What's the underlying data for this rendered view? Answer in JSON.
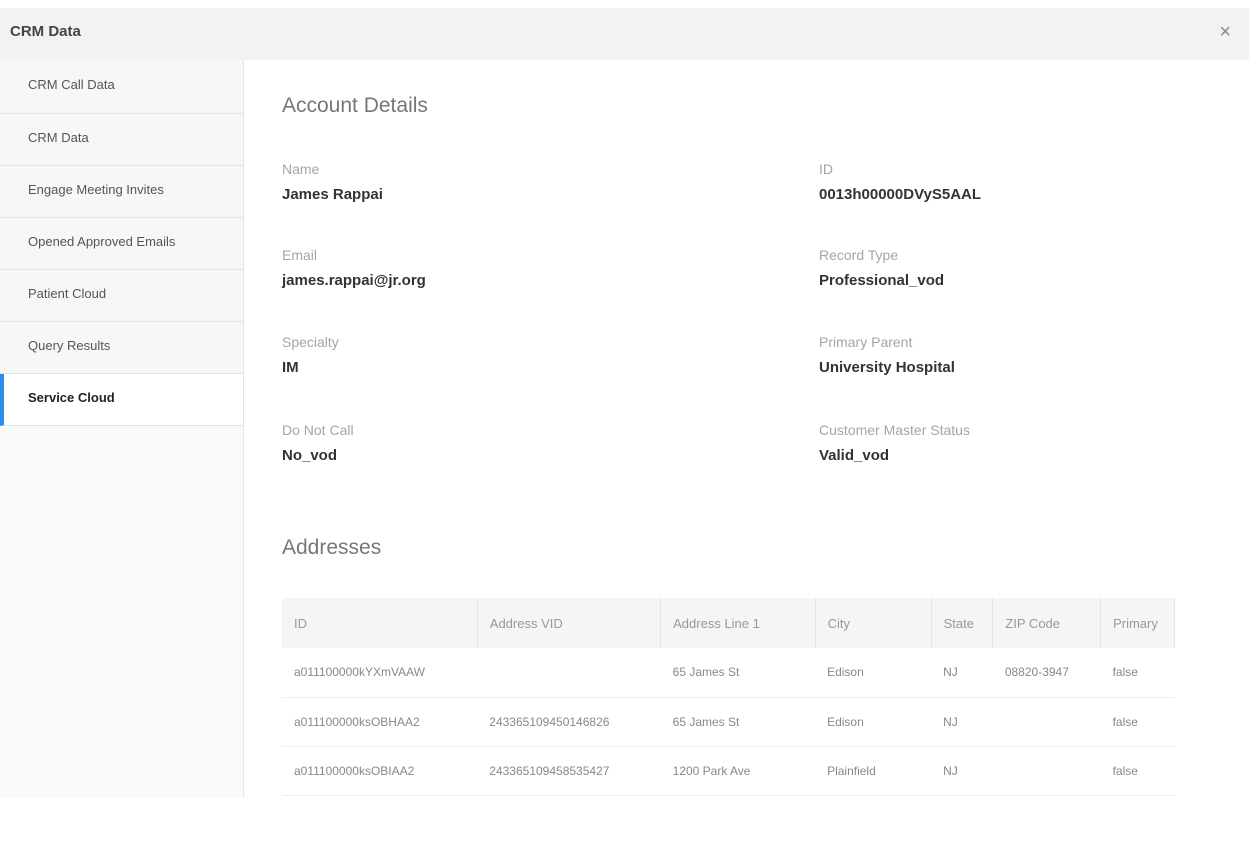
{
  "window": {
    "title": "CRM Data",
    "close_label": "×"
  },
  "sidebar": {
    "items": [
      {
        "label": "CRM Call Data"
      },
      {
        "label": "CRM Data"
      },
      {
        "label": "Engage Meeting Invites"
      },
      {
        "label": "Opened Approved Emails"
      },
      {
        "label": "Patient Cloud"
      },
      {
        "label": "Query Results"
      },
      {
        "label": "Service Cloud"
      }
    ],
    "active_item": "Service Cloud"
  },
  "account": {
    "section_title": "Account Details",
    "fields": {
      "name": {
        "label": "Name",
        "value": "James Rappai"
      },
      "id": {
        "label": "ID",
        "value": "0013h00000DVyS5AAL"
      },
      "email": {
        "label": "Email",
        "value": "james.rappai@jr.org"
      },
      "record_type": {
        "label": "Record Type",
        "value": "Professional_vod"
      },
      "specialty": {
        "label": "Specialty",
        "value": "IM"
      },
      "primary_parent": {
        "label": "Primary Parent",
        "value": "University Hospital"
      },
      "do_not_call": {
        "label": "Do Not Call",
        "value": "No_vod"
      },
      "customer_master_status": {
        "label": "Customer Master Status",
        "value": "Valid_vod"
      }
    }
  },
  "addresses": {
    "section_title": "Addresses",
    "columns": [
      "ID",
      "Address VID",
      "Address Line 1",
      "City",
      "State",
      "ZIP Code",
      "Primary"
    ],
    "rows": [
      [
        "a011100000kYXmVAAW",
        "",
        "65 James St",
        "Edison",
        "NJ",
        "08820-3947",
        "false"
      ],
      [
        "a011100000ksOBHAA2",
        "243365109450146826",
        "65 James St",
        "Edison",
        "NJ",
        "",
        "false"
      ],
      [
        "a011100000ksOBIAA2",
        "243365109458535427",
        "1200 Park Ave",
        "Plainfield",
        "NJ",
        "",
        "false"
      ]
    ]
  },
  "colors": {
    "accent": "#2b8ce6",
    "header_bg": "#f2f2f2"
  }
}
